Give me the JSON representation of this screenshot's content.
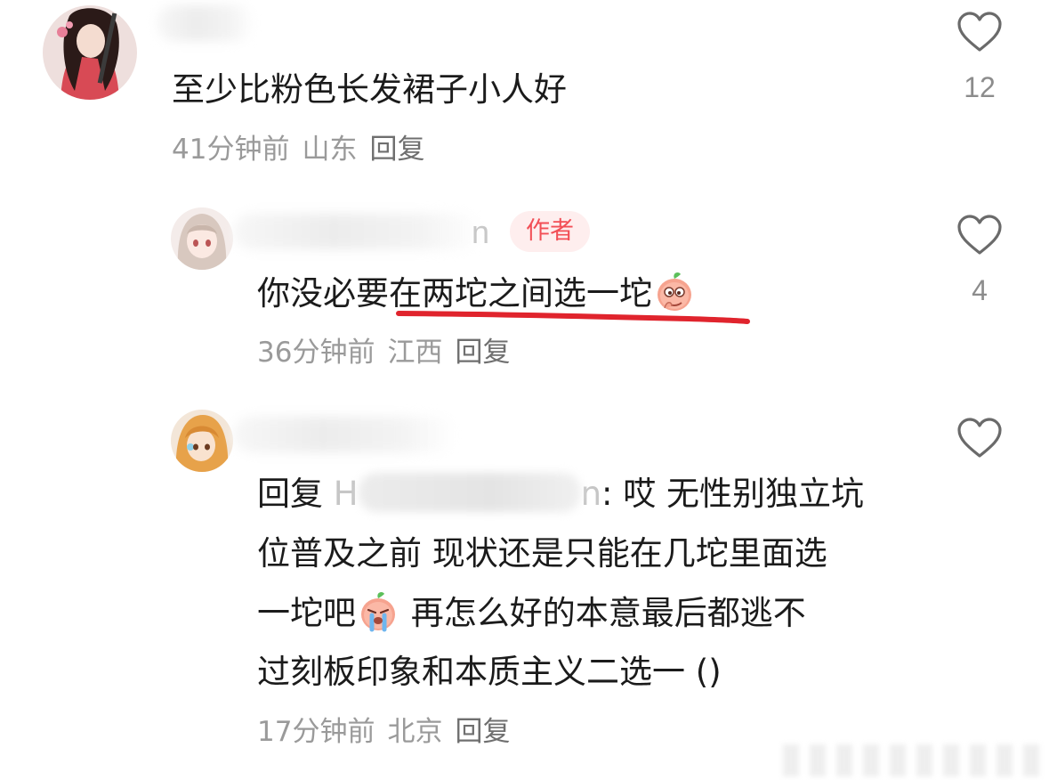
{
  "comments": [
    {
      "text": "至少比粉色长发裙子小人好",
      "time": "41分钟前",
      "location": "山东",
      "reply_label": "回复",
      "likes": "12",
      "avatar": "anime-girl-red-kimono-avatar"
    },
    {
      "name_tail": "n",
      "author_badge": "作者",
      "text": "你没必要在两坨之间选一坨",
      "emoji": "peach-face-emoji",
      "time": "36分钟前",
      "location": "江西",
      "reply_label": "回复",
      "likes": "4",
      "avatar": "anime-girl-beige-hair-avatar"
    },
    {
      "reply_prefix": "回复",
      "reply_to_first_char": "H",
      "reply_to_last_char": "n",
      "line1_rest": ": 哎 无性别独立坑",
      "line2": "位普及之前 现状还是只能在几坨里面选",
      "line3_start": "一坨吧",
      "line3_emoji": "crying-peach-emoji",
      "line3_end": " 再怎么好的本意最后都逃不",
      "line4": "过刻板印象和本质主义二选一 ()",
      "time": "17分钟前",
      "location": "北京",
      "reply_label": "回复",
      "avatar": "anime-girl-orange-hair-avatar"
    }
  ],
  "colors": {
    "author_badge_bg": "#feeeee",
    "author_badge_text": "#f24f56",
    "underline": "#e0242d",
    "meta_text": "#9a9a9a"
  },
  "icons": {
    "like": "heart-outline-icon"
  }
}
